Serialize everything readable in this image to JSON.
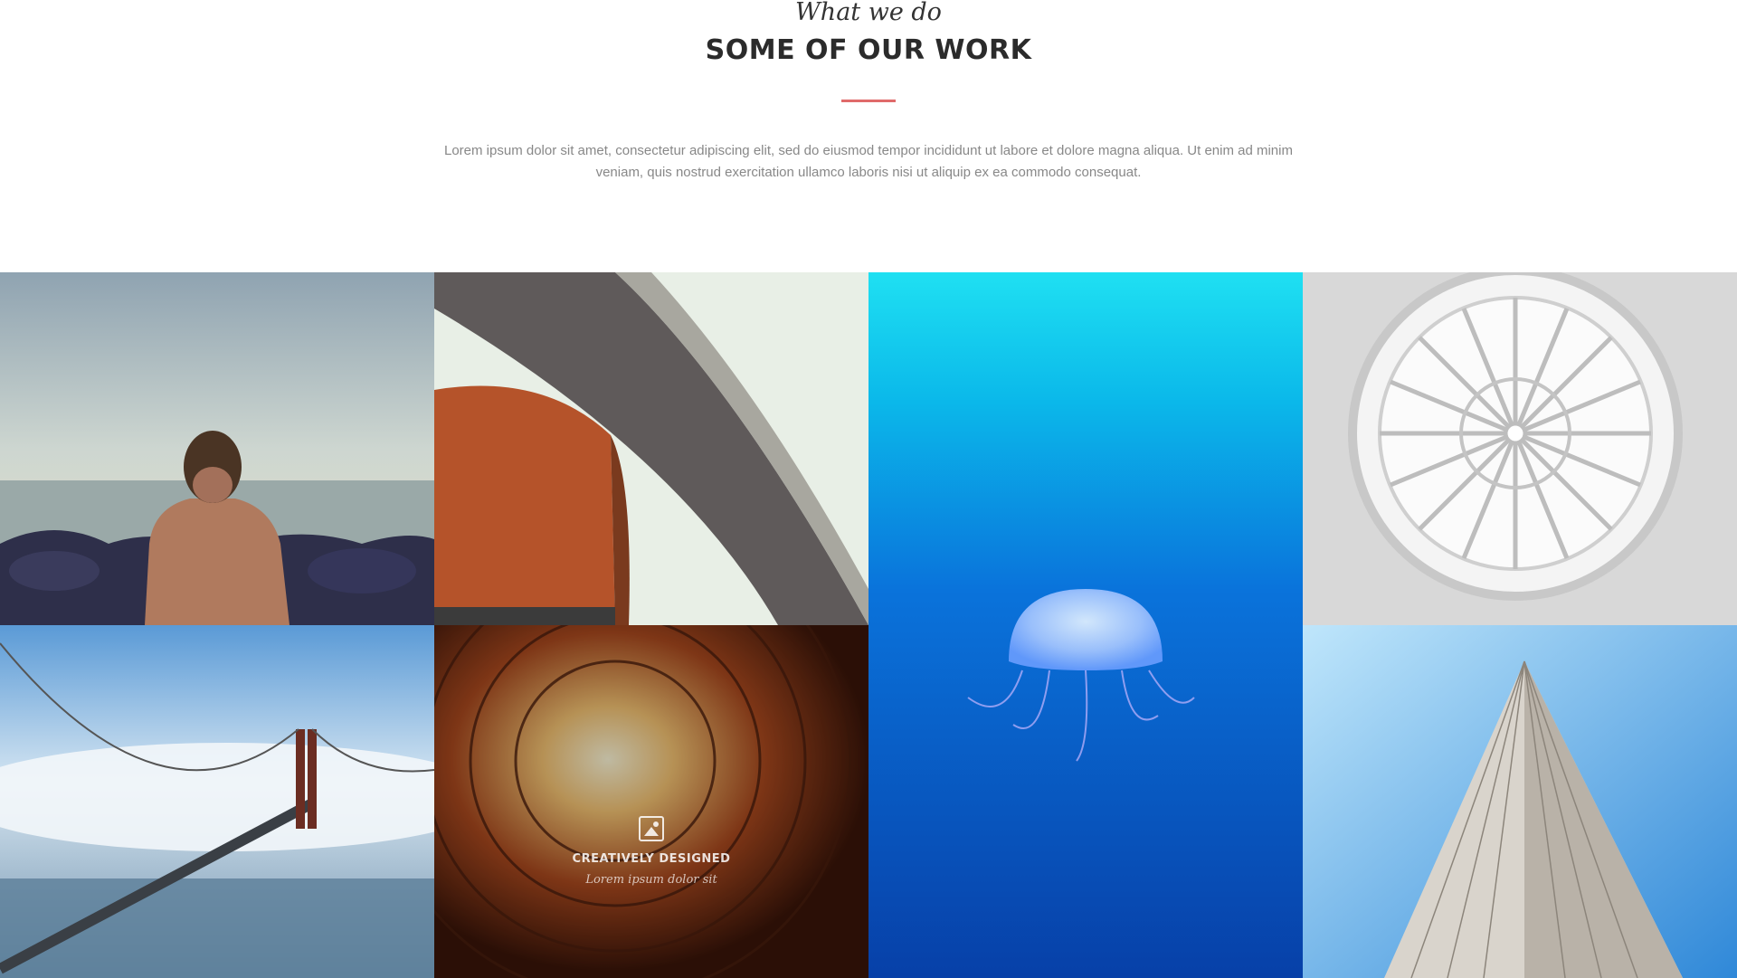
{
  "section": {
    "eyebrow": "What we do",
    "title": "SOME OF OUR WORK",
    "intro": "Lorem ipsum dolor sit amet, consectetur adipiscing elit, sed do eiusmod tempor incididunt ut labore et dolore magna aliqua. Ut enim ad minim veniam, quis nostrud exercitation ullamco laboris nisi ut aliquip ex ea commodo consequat."
  },
  "accent_color": "#e06a6a",
  "portfolio": {
    "items": [
      {
        "name": "man-at-shore"
      },
      {
        "name": "curved-building"
      },
      {
        "name": "jellyfish"
      },
      {
        "name": "glass-dome"
      },
      {
        "name": "golden-gate-bridge"
      },
      {
        "name": "courtyard-upward",
        "overlay_icon": "image-icon",
        "overlay_title": "CREATIVELY DESIGNED",
        "overlay_subtitle": "Lorem ipsum dolor sit"
      },
      {
        "name": "skyscraper"
      }
    ]
  }
}
